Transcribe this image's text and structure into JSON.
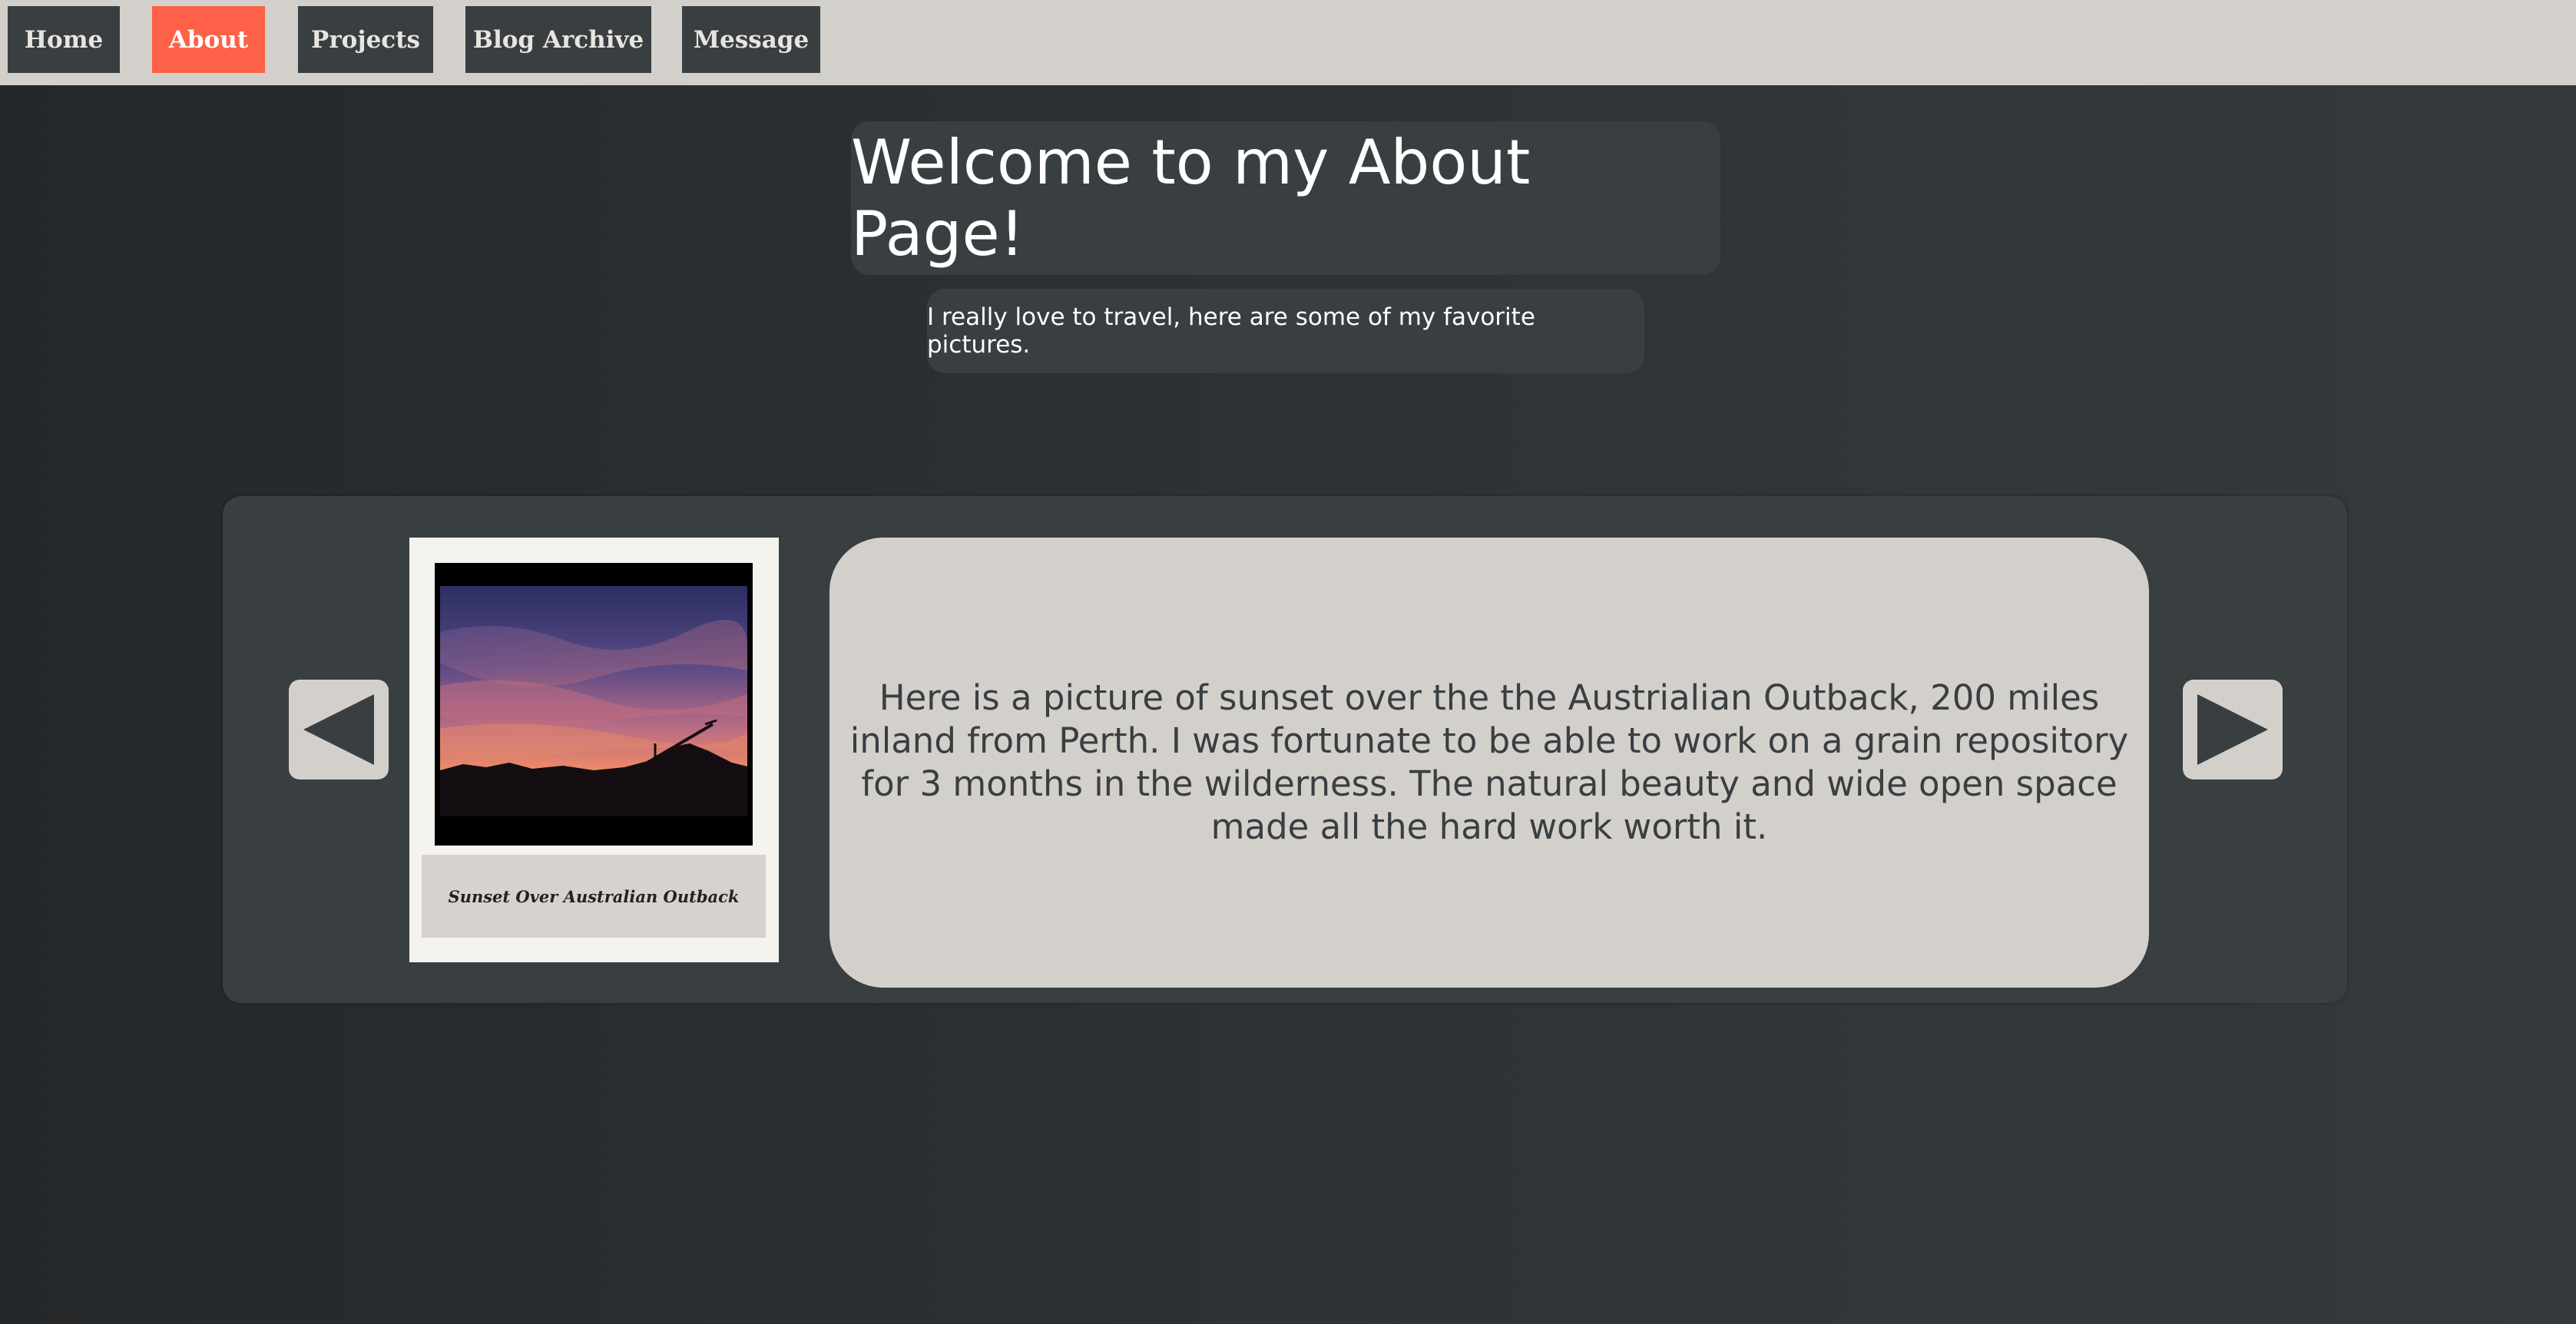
{
  "nav": {
    "items": [
      {
        "label": "Home",
        "active": false
      },
      {
        "label": "About",
        "active": true
      },
      {
        "label": "Projects",
        "active": false
      },
      {
        "label": "Blog Archive",
        "active": false
      },
      {
        "label": "Message",
        "active": false
      }
    ]
  },
  "header": {
    "title": "Welcome to my About Page!",
    "subtitle": "I really love to travel, here are some of my favorite pictures."
  },
  "gallery": {
    "prev_icon": "triangle-left-icon",
    "next_icon": "triangle-right-icon",
    "photo": {
      "caption": "Sunset Over Australian Outback"
    },
    "description": "Here is a picture of sunset over the the Austrialian Outback, 200 miles inland from Perth. I was fortunate to be able to work on a grain repository for 3 months in the wilderness. The natural beauty and wide open space made all the hard work worth it."
  },
  "colors": {
    "nav_bg": "#d3d0cb",
    "button_bg": "#393e41",
    "accent": "#fe6048",
    "panel_bg": "#393e41",
    "card_bg": "#d3d0cb"
  }
}
